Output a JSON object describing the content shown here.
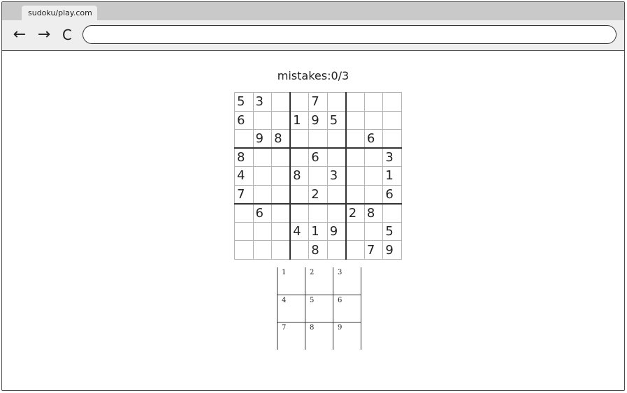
{
  "browser": {
    "tab_title": "sudoku/play.com",
    "address_value": "",
    "nav": {
      "back": "←",
      "forward": "→",
      "reload": "C"
    }
  },
  "game": {
    "mistakes_text": "mistakes:0/3",
    "board": [
      [
        "5",
        "3",
        "",
        "",
        "7",
        "",
        "",
        "",
        ""
      ],
      [
        "6",
        "",
        "",
        "1",
        "9",
        "5",
        "",
        "",
        ""
      ],
      [
        "",
        "9",
        "8",
        "",
        "",
        "",
        "",
        "6",
        ""
      ],
      [
        "8",
        "",
        "",
        "",
        "6",
        "",
        "",
        "",
        "3"
      ],
      [
        "4",
        "",
        "",
        "8",
        "",
        "3",
        "",
        "",
        "1"
      ],
      [
        "7",
        "",
        "",
        "",
        "2",
        "",
        "",
        "",
        "6"
      ],
      [
        "",
        "6",
        "",
        "",
        "",
        "",
        "2",
        "8",
        ""
      ],
      [
        "",
        "",
        "",
        "4",
        "1",
        "9",
        "",
        "",
        "5"
      ],
      [
        "",
        "",
        "",
        "",
        "8",
        "",
        "",
        "7",
        "9"
      ]
    ],
    "numpad": [
      [
        "1",
        "2",
        "3"
      ],
      [
        "4",
        "5",
        "6"
      ],
      [
        "7",
        "8",
        "9"
      ]
    ]
  }
}
